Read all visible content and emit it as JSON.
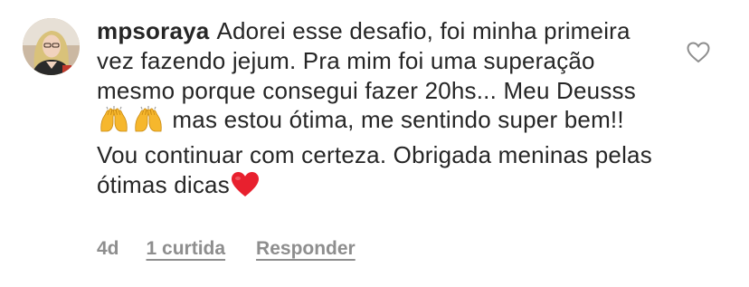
{
  "comment": {
    "username": "mpsoraya",
    "text_part1": "Adorei esse desafio, foi minha primeira vez fazendo jejum. Pra mim foi uma superação mesmo porque consegui fazer 20hs... Meu Deusss",
    "emoji_1": "raising-hands-emoji",
    "emoji_2": "raising-hands-emoji",
    "text_part2": " mas estou ótima, me sentindo super bem!! Vou continuar com certeza. Obrigada meninas pelas ótimas dicas",
    "emoji_3": "red-heart-emoji",
    "time": "4d",
    "likes": "1 curtida",
    "reply": "Responder"
  },
  "colors": {
    "text": "#262626",
    "secondary": "#8e8e8e",
    "heart_emoji": "#e8202e",
    "hands_emoji": "#f6b72d"
  }
}
